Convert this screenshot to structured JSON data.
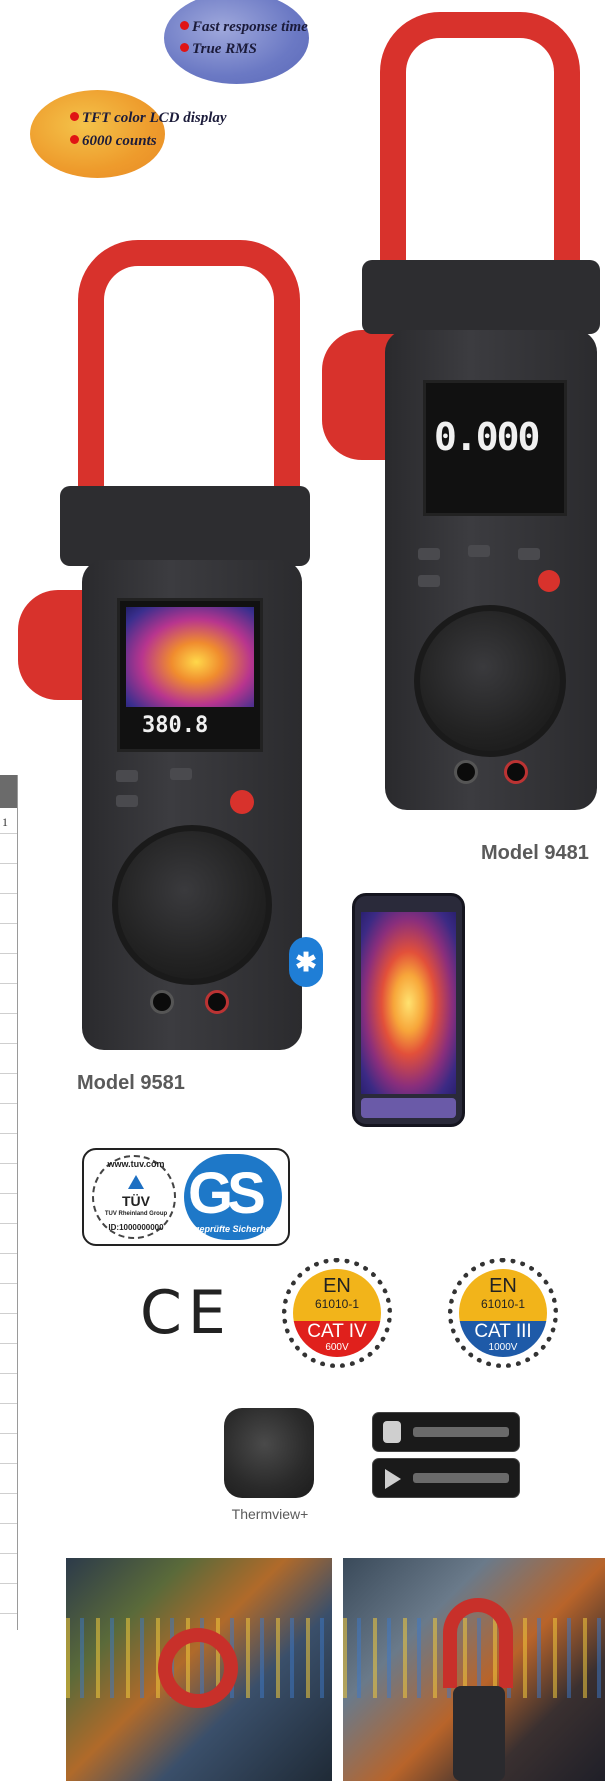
{
  "features_top": [
    "Fast response time",
    "True RMS"
  ],
  "features_left": [
    "TFT color LCD display",
    "6000 counts"
  ],
  "table_edge": {
    "first_cell": "1"
  },
  "meter_9481": {
    "reading": "0.000",
    "model_label": "Model 9481"
  },
  "meter_9581": {
    "reading": "380.8",
    "model_label": "Model 9581"
  },
  "certifications": {
    "tuv": {
      "ring_text": "www.tuv.com",
      "name": "TÜV",
      "group": "TUV Rheinland Group",
      "id": "ID:1000000000",
      "gs_note": "geprüfte Sicherheit"
    },
    "ce": "CE",
    "badge_cat4": {
      "en": "EN",
      "std": "61010-1",
      "cat": "CAT IV",
      "volt": "600V",
      "color": "#e0201c"
    },
    "badge_cat3": {
      "en": "EN",
      "std": "61010-1",
      "cat": "CAT III",
      "volt": "1000V",
      "color": "#1e5aa8"
    }
  },
  "app": {
    "name": "Thermview+",
    "icon": "thermview-app-icon",
    "stores": [
      "app-store-badge",
      "google-play-badge"
    ]
  },
  "bluetooth_icon": "bluetooth-icon"
}
